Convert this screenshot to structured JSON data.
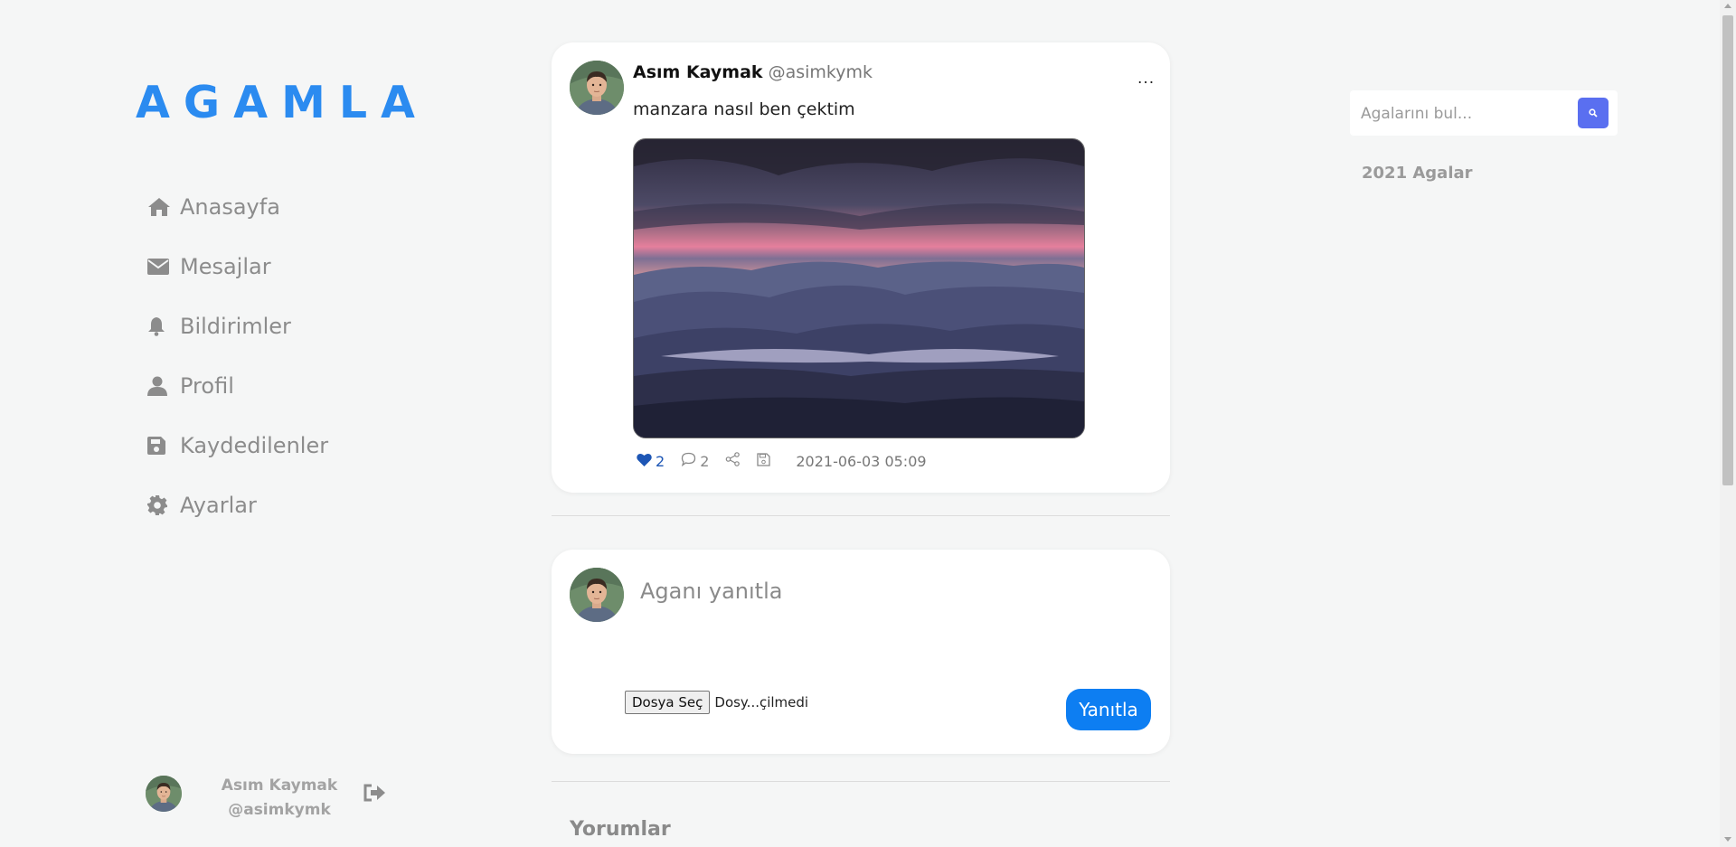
{
  "app": {
    "logo": "AGAMLA"
  },
  "sidebar": {
    "items": [
      {
        "label": "Anasayfa",
        "icon": "home-icon"
      },
      {
        "label": "Mesajlar",
        "icon": "envelope-icon"
      },
      {
        "label": "Bildirimler",
        "icon": "bell-icon"
      },
      {
        "label": "Profil",
        "icon": "user-icon"
      },
      {
        "label": "Kaydedilenler",
        "icon": "save-icon"
      },
      {
        "label": "Ayarlar",
        "icon": "gear-icon"
      }
    ],
    "user": {
      "name": "Asım Kaymak",
      "handle": "@asimkymk",
      "logout_icon": "sign-out-icon"
    }
  },
  "post": {
    "author_name": "Asım Kaymak",
    "author_handle": "@asimkymk",
    "more": "...",
    "text": "manzara nasıl ben çektim",
    "image": "mountain-sunset-image",
    "likes": "2",
    "comments": "2",
    "date": "2021-06-03 05:09"
  },
  "reply": {
    "placeholder": "Aganı yanıtla",
    "file_button": "Dosya Seç",
    "file_status": "Dosy...çilmedi",
    "submit": "Yanıtla"
  },
  "comments": {
    "title": "Yorumlar"
  },
  "right": {
    "search_placeholder": "Agalarını bul...",
    "search_icon": "search-icon",
    "year_label": "2021 Agalar"
  },
  "colors": {
    "brand": "#2b8bf0",
    "reply_button": "#0d7ef2",
    "search_button": "#5a6ff0",
    "like": "#1d56b5"
  }
}
